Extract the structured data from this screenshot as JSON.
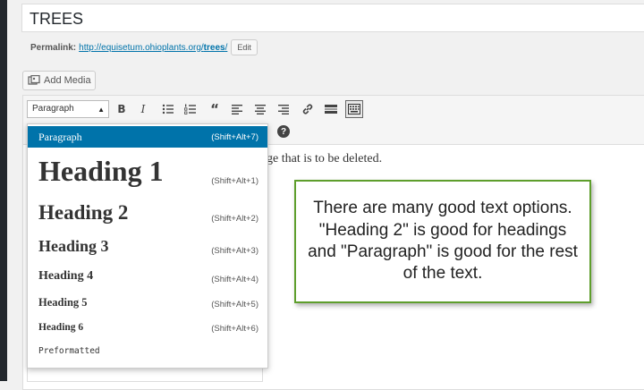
{
  "post": {
    "title": "TREES",
    "permalink_label": "Permalink:",
    "permalink_base": "http://equisetum.ohioplants.org/",
    "permalink_slug": "trees",
    "permalink_end": "/",
    "edit_label": "Edit"
  },
  "add_media_label": "Add Media",
  "toolbar": {
    "format_value": "Paragraph",
    "bold_icon": "bold-icon",
    "italic_icon": "italic-icon",
    "bulleted_list_icon": "bulleted-list-icon",
    "numbered_list_icon": "numbered-list-icon",
    "blockquote_icon": "blockquote-icon",
    "align_left_icon": "align-left-icon",
    "align_center_icon": "align-center-icon",
    "align_right_icon": "align-right-icon",
    "link_icon": "link-icon",
    "read_more_icon": "read-more-icon",
    "toolbar_toggle_icon": "toolbar-toggle-icon",
    "help_icon": "help-icon"
  },
  "content_text": "ge that is to be deleted.",
  "format_dropdown": {
    "items": [
      {
        "label": "Paragraph",
        "shortcut": "(Shift+Alt+7)"
      },
      {
        "label": "Heading 1",
        "shortcut": "(Shift+Alt+1)"
      },
      {
        "label": "Heading 2",
        "shortcut": "(Shift+Alt+2)"
      },
      {
        "label": "Heading 3",
        "shortcut": "(Shift+Alt+3)"
      },
      {
        "label": "Heading 4",
        "shortcut": "(Shift+Alt+4)"
      },
      {
        "label": "Heading 5",
        "shortcut": "(Shift+Alt+5)"
      },
      {
        "label": "Heading 6",
        "shortcut": "(Shift+Alt+6)"
      },
      {
        "label": "Preformatted",
        "shortcut": ""
      }
    ]
  },
  "callout_text": "There are many good text options. \"Heading 2\" is good for headings and \"Paragraph\" is good for the rest of the text.",
  "colors": {
    "selected_bg": "#0073aa",
    "callout_border": "#5e9e2c",
    "admin_bar": "#23282d"
  }
}
